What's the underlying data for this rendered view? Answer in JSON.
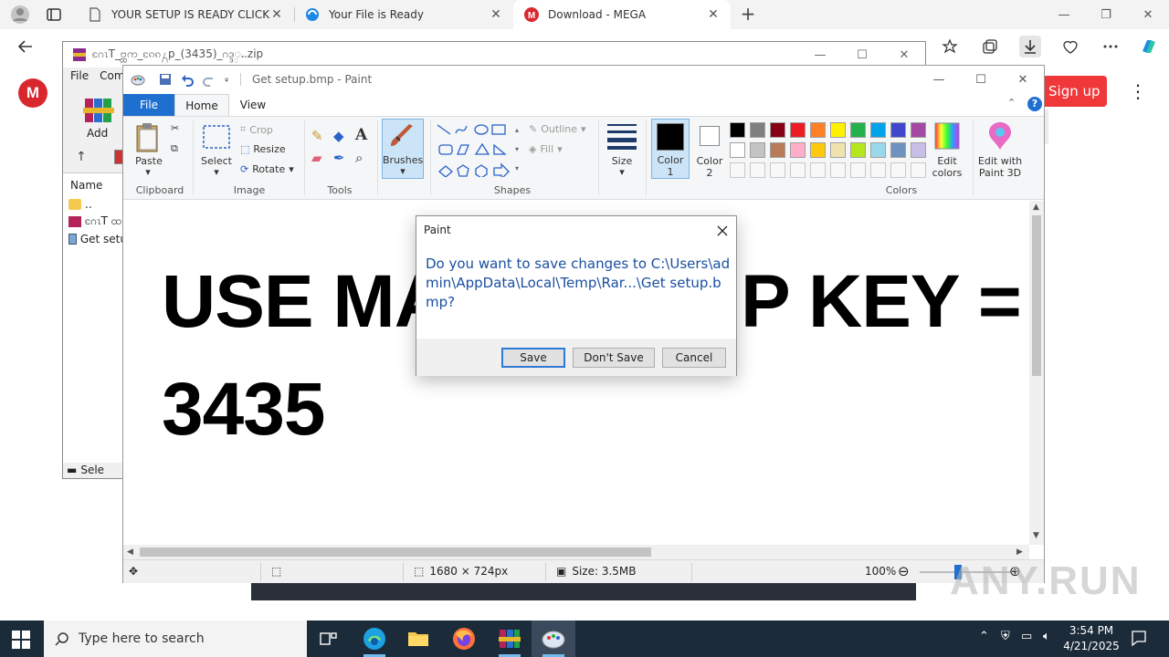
{
  "browser": {
    "tabs": [
      {
        "title": "YOUR SETUP IS READY CLICK BELOW",
        "icon": "document-icon"
      },
      {
        "title": "Your File is Ready",
        "icon": "blue-arrows-icon"
      },
      {
        "title": "Download - MEGA",
        "icon": "mega-icon"
      }
    ]
  },
  "mega": {
    "logo": "M",
    "signup": "Sign up",
    "colors": {
      "brand": "#d9272e",
      "signup": "#f0373a"
    }
  },
  "winrar": {
    "title": "ဂႄၤT_ဗ္ထက_ၵႄၵ႓p_(3435)_ဂဒ္ဒ္ႉ.zip",
    "menu": [
      "File",
      "Com"
    ],
    "add_label": "Add",
    "column_name": "Name",
    "rows": [
      "..",
      "ဂႄၤT ထ",
      "Get setu"
    ],
    "status": "Sele"
  },
  "paint": {
    "title": "Get setup.bmp - Paint",
    "tabs": {
      "file": "File",
      "home": "Home",
      "view": "View"
    },
    "ribbon": {
      "clipboard": {
        "paste": "Paste",
        "label": "Clipboard"
      },
      "image": {
        "select": "Select",
        "crop": "Crop",
        "resize": "Resize",
        "rotate": "Rotate",
        "label": "Image"
      },
      "tools_label": "Tools",
      "brushes": "Brushes",
      "shapes": {
        "outline": "Outline",
        "fill": "Fill",
        "label": "Shapes"
      },
      "size": "Size",
      "color1": "Color\n1",
      "color2": "Color\n2",
      "colors_label": "Colors",
      "edit_colors": "Edit\ncolors",
      "edit_3d": "Edit with\nPaint 3D"
    },
    "palette_row1": [
      "#000000",
      "#7f7f7f",
      "#880015",
      "#ed1c24",
      "#ff7f27",
      "#fff200",
      "#22b14c",
      "#00a2e8",
      "#3f48cc",
      "#a349a4"
    ],
    "palette_row2": [
      "#ffffff",
      "#c3c3c3",
      "#b97a57",
      "#ffaec9",
      "#ffc90e",
      "#efe4b0",
      "#b5e61d",
      "#99d9ea",
      "#7092be",
      "#c8bfe7"
    ],
    "canvas": {
      "line1": "USE MA",
      "line1_end": "P KEY =",
      "line2": "3435"
    },
    "status": {
      "dimensions": "1680 × 724px",
      "size": "Size: 3.5MB",
      "zoom": "100%"
    }
  },
  "dialog": {
    "title": "Paint",
    "message": "Do you want to save changes to C:\\Users\\admin\\AppData\\Local\\Temp\\Rar...\\Get setup.bmp?",
    "save": "Save",
    "dont_save": "Don't Save",
    "cancel": "Cancel"
  },
  "taskbar": {
    "search_placeholder": "Type here to search",
    "time": "3:54 PM",
    "date": "4/21/2025"
  },
  "watermark": "ANY.RUN"
}
